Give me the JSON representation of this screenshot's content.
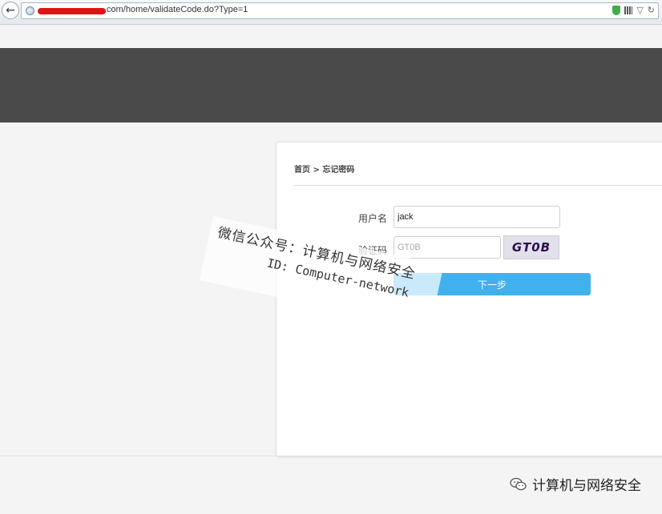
{
  "browser": {
    "url_visible": "com/home/validateCode.do?Type=1"
  },
  "card": {
    "breadcrumb": "首页 > 忘记密码",
    "username_label": "用户名",
    "username_value": "jack",
    "captcha_label": "验证码",
    "captcha_value": "GT0B",
    "captcha_image_text": "GT0B",
    "next_button": "下一步"
  },
  "watermark": {
    "line1": "微信公众号：计算机与网络安全",
    "line2": "ID: Computer-network"
  },
  "footer": {
    "brand": "计算机与网络安全"
  },
  "colors": {
    "header_band": "#4a4a4a",
    "button": "#41b1ee",
    "captcha_text": "#2b1050"
  }
}
